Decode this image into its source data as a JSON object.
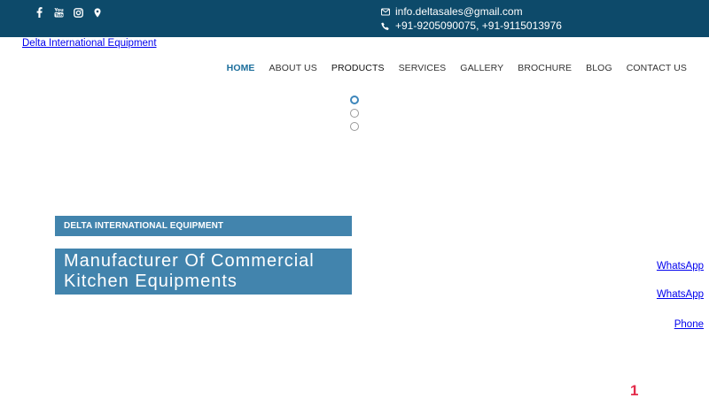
{
  "topbar": {
    "social_icons": [
      "facebook-icon",
      "youtube-icon",
      "instagram-icon",
      "location-icon"
    ],
    "email": "info.deltasales@gmail.com",
    "phone": "+91-9205090075, +91-9115013976"
  },
  "brand": {
    "name": "Delta International Equipment"
  },
  "nav": {
    "items": [
      {
        "label": "HOME"
      },
      {
        "label": "ABOUT US"
      },
      {
        "label": "PRODUCTS"
      },
      {
        "label": "SERVICES"
      },
      {
        "label": "GALLERY"
      },
      {
        "label": "BROCHURE"
      },
      {
        "label": "BLOG"
      },
      {
        "label": "CONTACT US"
      }
    ]
  },
  "hero": {
    "tag": "DELTA INTERNATIONAL EQUIPMENT",
    "headline_line1": "Manufacturer Of Commercial",
    "headline_line2": "Kitchen Equipments",
    "slide_count": 3,
    "active_slide": 1
  },
  "floating": {
    "whatsapp_1": "WhatsApp",
    "whatsapp_2": "WhatsApp",
    "phone": "Phone"
  },
  "badge": {
    "count": "1"
  },
  "colors": {
    "topbar": "#0d4a6a",
    "accent": "#4284ad",
    "nav_active": "#1d6f9c",
    "badge": "#e32b4a"
  }
}
